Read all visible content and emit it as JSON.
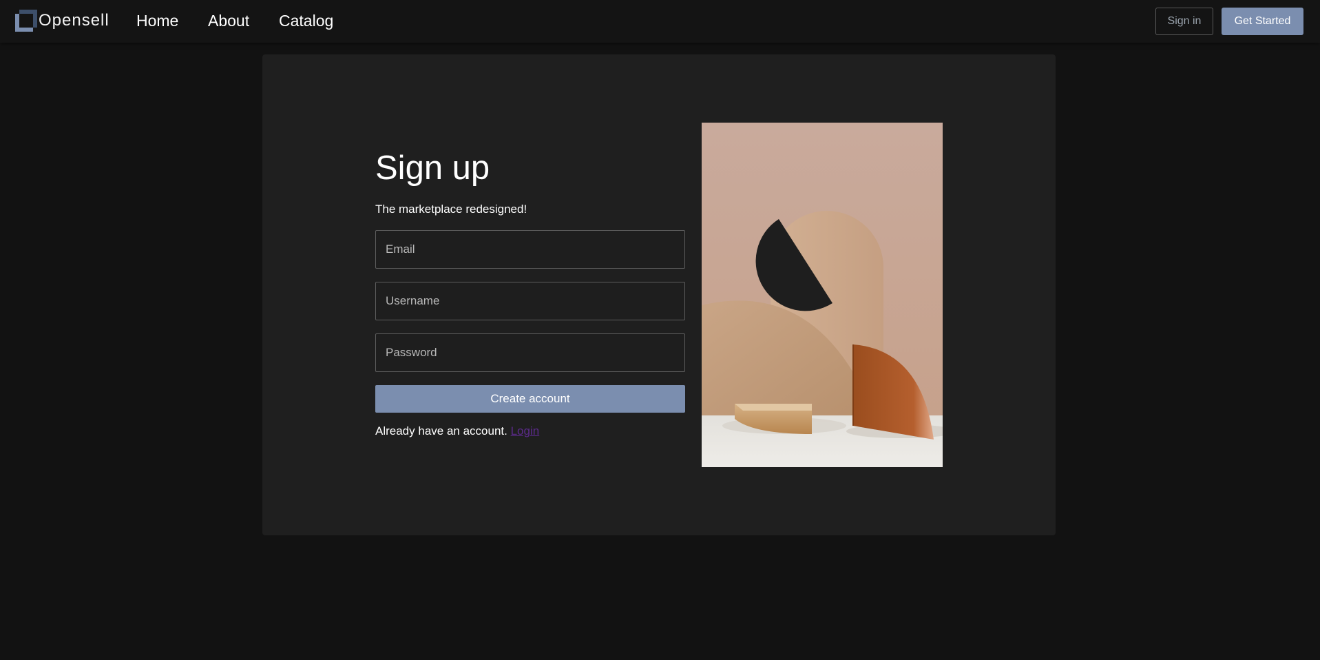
{
  "navbar": {
    "brand": "Opensell",
    "links": [
      {
        "label": "Home"
      },
      {
        "label": "About"
      },
      {
        "label": "Catalog"
      }
    ],
    "signin_label": "Sign in",
    "get_started_label": "Get Started"
  },
  "signup": {
    "title": "Sign up",
    "subtitle": "The marketplace redesigned!",
    "email_placeholder": "Email",
    "username_placeholder": "Username",
    "password_placeholder": "Password",
    "create_label": "Create account",
    "already_text": "Already have an account.",
    "login_label": "Login"
  },
  "colors": {
    "background": "#121212",
    "navbar": "#141414",
    "card": "#1f1f1f",
    "accent": "#7b8eaf",
    "link": "#5b2a8a"
  },
  "icons": {
    "brand_logo": "opensell-logo-icon"
  }
}
